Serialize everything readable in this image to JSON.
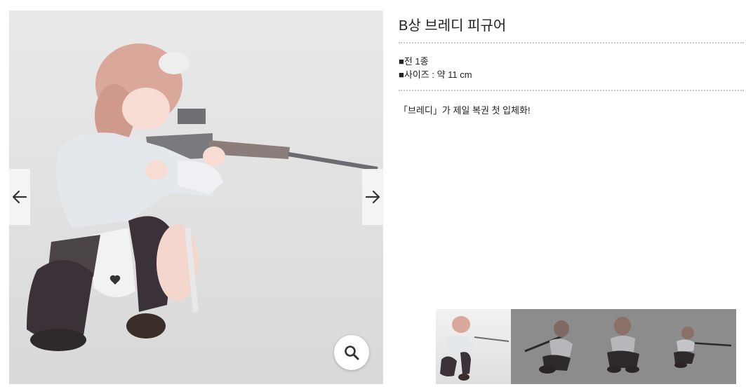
{
  "product": {
    "title": "B상 브레디 피규어",
    "specs": [
      "■전 1종",
      "■사이즈 : 약 11 cm"
    ],
    "description": "「브레디」가 제일 복권 첫 입체화!"
  },
  "gallery": {
    "prev_icon": "arrow-left-icon",
    "next_icon": "arrow-right-icon",
    "zoom_icon": "magnifier-icon",
    "thumbnail_count": 4,
    "active_thumbnail": 1
  },
  "colors": {
    "hair": "#d9a89a",
    "jacket": "#e4e7ec",
    "stockings": "#3a3238",
    "rifle": "#6e6e72",
    "thumb_inactive": "#8c8c8c"
  }
}
